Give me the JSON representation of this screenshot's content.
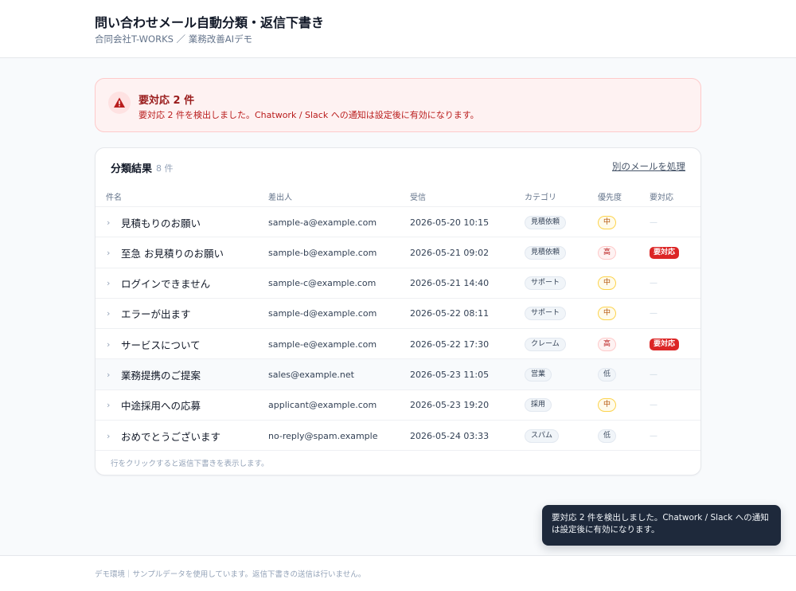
{
  "header": {
    "title": "問い合わせメール自動分類・返信下書き",
    "subtitle": "合同会社T-WORKS ／ 業務改善AIデモ"
  },
  "alert": {
    "icon": "warning-icon",
    "title": "要対応 2 件",
    "message": "要対応 2 件を検出しました。Chatwork / Slack への通知は設定後に有効になります。",
    "color": "#b91c1c"
  },
  "results": {
    "title": "分類結果",
    "count": "8 件",
    "process_link": "別のメールを処理",
    "columns": [
      "件名",
      "差出人",
      "受信",
      "カテゴリ",
      "優先度",
      "要対応"
    ],
    "rows": [
      {
        "subject": "見積もりのお願い",
        "from": "sample-a@example.com",
        "received": "2026-05-20 10:15",
        "category": "見積依頼",
        "priority": "中",
        "priority_level": "mid",
        "action": "—"
      },
      {
        "subject": "至急 お見積りのお願い",
        "from": "sample-b@example.com",
        "received": "2026-05-21 09:02",
        "category": "見積依頼",
        "priority": "高",
        "priority_level": "high",
        "action": "要対応"
      },
      {
        "subject": "ログインできません",
        "from": "sample-c@example.com",
        "received": "2026-05-21 14:40",
        "category": "サポート",
        "priority": "中",
        "priority_level": "mid",
        "action": "—"
      },
      {
        "subject": "エラーが出ます",
        "from": "sample-d@example.com",
        "received": "2026-05-22 08:11",
        "category": "サポート",
        "priority": "中",
        "priority_level": "mid",
        "action": "—"
      },
      {
        "subject": "サービスについて",
        "from": "sample-e@example.com",
        "received": "2026-05-22 17:30",
        "category": "クレーム",
        "priority": "高",
        "priority_level": "high",
        "action": "要対応"
      },
      {
        "subject": "業務提携のご提案",
        "from": "sales@example.net",
        "received": "2026-05-23 11:05",
        "category": "営業",
        "priority": "低",
        "priority_level": "low",
        "action": "—"
      },
      {
        "subject": "中途採用への応募",
        "from": "applicant@example.com",
        "received": "2026-05-23 19:20",
        "category": "採用",
        "priority": "中",
        "priority_level": "mid",
        "action": "—"
      },
      {
        "subject": "おめでとうございます",
        "from": "no-reply@spam.example",
        "received": "2026-05-24 03:33",
        "category": "スパム",
        "priority": "低",
        "priority_level": "low",
        "action": "—"
      }
    ],
    "hint": "行をクリックすると返信下書きを表示します。"
  },
  "toast": {
    "message": "要対応 2 件を検出しました。Chatwork / Slack への通知は設定後に有効になります。"
  },
  "footer": {
    "text": "デモ環境｜サンプルデータを使用しています。返信下書きの送信は行いません。"
  },
  "colors": {
    "alert_bg": "#fef2f2",
    "action_badge": "#dc2626",
    "toast_bg": "#1e293b"
  }
}
